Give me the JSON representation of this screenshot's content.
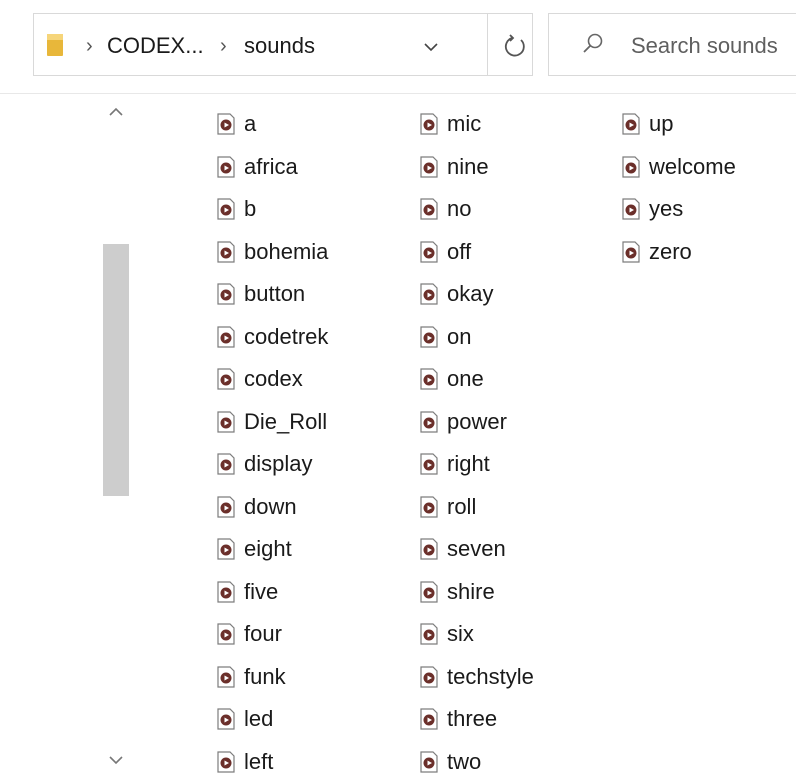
{
  "address_bar": {
    "breadcrumbs": [
      "CODEX...",
      "sounds"
    ]
  },
  "search": {
    "placeholder": "Search sounds"
  },
  "columns": [
    [
      "a",
      "africa",
      "b",
      "bohemia",
      "button",
      "codetrek",
      "codex",
      "Die_Roll",
      "display",
      "down",
      "eight",
      "five",
      "four",
      "funk",
      "led",
      "left"
    ],
    [
      "mic",
      "nine",
      "no",
      "off",
      "okay",
      "on",
      "one",
      "power",
      "right",
      "roll",
      "seven",
      "shire",
      "six",
      "techstyle",
      "three",
      "two"
    ],
    [
      "up",
      "welcome",
      "yes",
      "zero"
    ]
  ],
  "icons": {
    "folder": "folder-icon",
    "file": "audio-file-icon",
    "refresh": "refresh-icon",
    "search": "search-icon"
  },
  "colors": {
    "folder": "#f2c94c",
    "file_icon_accent": "#7a3b2e",
    "scroll_thumb": "#cdcdcd"
  }
}
